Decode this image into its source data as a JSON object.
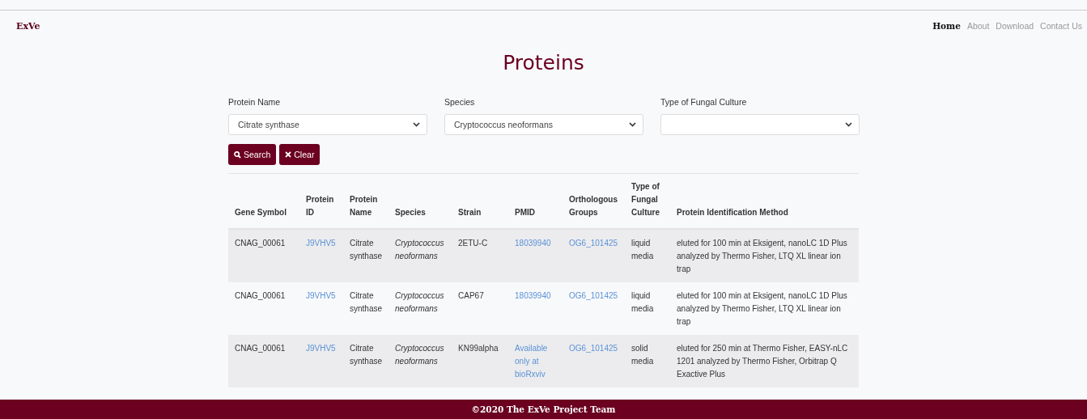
{
  "brand": "ExVe",
  "nav": [
    {
      "label": "Home",
      "selected": true
    },
    {
      "label": "About",
      "selected": false
    },
    {
      "label": "Download",
      "selected": false
    },
    {
      "label": "Contact Us",
      "selected": false
    }
  ],
  "title": "Proteins",
  "filters": [
    {
      "label": "Protein Name",
      "value": "Citrate synthase"
    },
    {
      "label": "Species",
      "value": "Cryptococcus neoformans"
    },
    {
      "label": "Type of Fungal Culture"
    }
  ],
  "buttons": [
    {
      "kind": "search",
      "label": "Search"
    },
    {
      "kind": "clear",
      "label": "Clear"
    }
  ],
  "table": {
    "columns": [
      {
        "label": "Gene Symbol",
        "kind": "text"
      },
      {
        "label": "Protein ID",
        "kind": "link"
      },
      {
        "label": "Protein Name",
        "kind": "text"
      },
      {
        "label": "Species",
        "kind": "italic"
      },
      {
        "label": "Strain",
        "kind": "text"
      },
      {
        "label": "PMID",
        "kind": "link"
      },
      {
        "label": "Orthologous Groups",
        "kind": "link"
      },
      {
        "label": "Type of Fungal Culture",
        "kind": "text"
      },
      {
        "label": "Protein Identification Method",
        "kind": "text"
      }
    ],
    "rows": [
      [
        "CNAG_00061",
        "J9VHV5",
        "Citrate synthase",
        "Cryptococcus neoformans",
        "2ETU-C",
        "18039940",
        "OG6_101425",
        "liquid media",
        "eluted for 100 min at Eksigent, nanoLC 1D Plus analyzed by Thermo Fisher, LTQ XL linear ion trap"
      ],
      [
        "CNAG_00061",
        "J9VHV5",
        "Citrate synthase",
        "Cryptococcus neoformans",
        "CAP67",
        "18039940",
        "OG6_101425",
        "liquid media",
        "eluted for 100 min at Eksigent, nanoLC 1D Plus analyzed by Thermo Fisher, LTQ XL linear ion trap"
      ],
      [
        "CNAG_00061",
        "J9VHV5",
        "Citrate synthase",
        "Cryptococcus neoformans",
        "KN99alpha",
        "Available only at bioRxviv",
        "OG6_101425",
        "solid media",
        "eluted for 250 min at Thermo Fisher, EASY-nLC 1201 analyzed by Thermo Fisher, Orbitrap Q Exactive Plus"
      ]
    ]
  },
  "footer": "©2020 The ExVe Project Team"
}
